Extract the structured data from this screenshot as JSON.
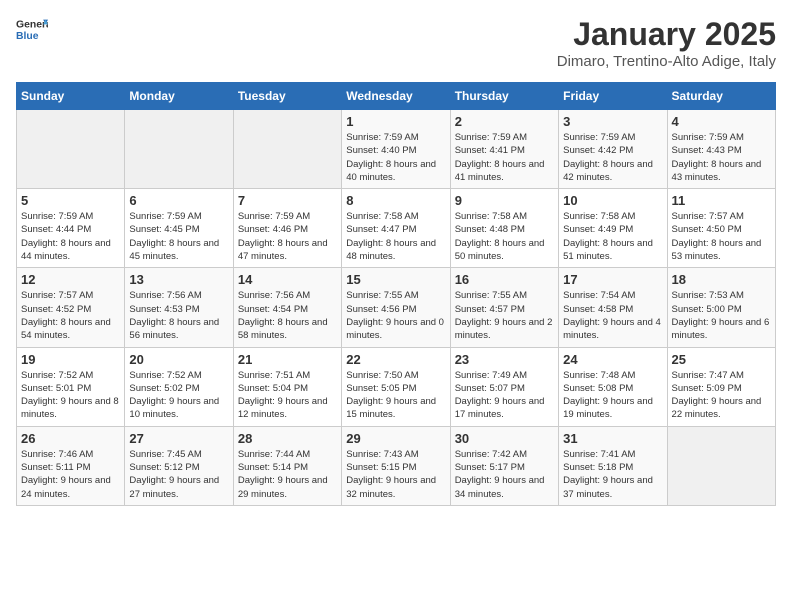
{
  "logo": {
    "text_general": "General",
    "text_blue": "Blue"
  },
  "title": "January 2025",
  "subtitle": "Dimaro, Trentino-Alto Adige, Italy",
  "weekdays": [
    "Sunday",
    "Monday",
    "Tuesday",
    "Wednesday",
    "Thursday",
    "Friday",
    "Saturday"
  ],
  "weeks": [
    [
      {
        "day": "",
        "info": ""
      },
      {
        "day": "",
        "info": ""
      },
      {
        "day": "",
        "info": ""
      },
      {
        "day": "1",
        "info": "Sunrise: 7:59 AM\nSunset: 4:40 PM\nDaylight: 8 hours and 40 minutes."
      },
      {
        "day": "2",
        "info": "Sunrise: 7:59 AM\nSunset: 4:41 PM\nDaylight: 8 hours and 41 minutes."
      },
      {
        "day": "3",
        "info": "Sunrise: 7:59 AM\nSunset: 4:42 PM\nDaylight: 8 hours and 42 minutes."
      },
      {
        "day": "4",
        "info": "Sunrise: 7:59 AM\nSunset: 4:43 PM\nDaylight: 8 hours and 43 minutes."
      }
    ],
    [
      {
        "day": "5",
        "info": "Sunrise: 7:59 AM\nSunset: 4:44 PM\nDaylight: 8 hours and 44 minutes."
      },
      {
        "day": "6",
        "info": "Sunrise: 7:59 AM\nSunset: 4:45 PM\nDaylight: 8 hours and 45 minutes."
      },
      {
        "day": "7",
        "info": "Sunrise: 7:59 AM\nSunset: 4:46 PM\nDaylight: 8 hours and 47 minutes."
      },
      {
        "day": "8",
        "info": "Sunrise: 7:58 AM\nSunset: 4:47 PM\nDaylight: 8 hours and 48 minutes."
      },
      {
        "day": "9",
        "info": "Sunrise: 7:58 AM\nSunset: 4:48 PM\nDaylight: 8 hours and 50 minutes."
      },
      {
        "day": "10",
        "info": "Sunrise: 7:58 AM\nSunset: 4:49 PM\nDaylight: 8 hours and 51 minutes."
      },
      {
        "day": "11",
        "info": "Sunrise: 7:57 AM\nSunset: 4:50 PM\nDaylight: 8 hours and 53 minutes."
      }
    ],
    [
      {
        "day": "12",
        "info": "Sunrise: 7:57 AM\nSunset: 4:52 PM\nDaylight: 8 hours and 54 minutes."
      },
      {
        "day": "13",
        "info": "Sunrise: 7:56 AM\nSunset: 4:53 PM\nDaylight: 8 hours and 56 minutes."
      },
      {
        "day": "14",
        "info": "Sunrise: 7:56 AM\nSunset: 4:54 PM\nDaylight: 8 hours and 58 minutes."
      },
      {
        "day": "15",
        "info": "Sunrise: 7:55 AM\nSunset: 4:56 PM\nDaylight: 9 hours and 0 minutes."
      },
      {
        "day": "16",
        "info": "Sunrise: 7:55 AM\nSunset: 4:57 PM\nDaylight: 9 hours and 2 minutes."
      },
      {
        "day": "17",
        "info": "Sunrise: 7:54 AM\nSunset: 4:58 PM\nDaylight: 9 hours and 4 minutes."
      },
      {
        "day": "18",
        "info": "Sunrise: 7:53 AM\nSunset: 5:00 PM\nDaylight: 9 hours and 6 minutes."
      }
    ],
    [
      {
        "day": "19",
        "info": "Sunrise: 7:52 AM\nSunset: 5:01 PM\nDaylight: 9 hours and 8 minutes."
      },
      {
        "day": "20",
        "info": "Sunrise: 7:52 AM\nSunset: 5:02 PM\nDaylight: 9 hours and 10 minutes."
      },
      {
        "day": "21",
        "info": "Sunrise: 7:51 AM\nSunset: 5:04 PM\nDaylight: 9 hours and 12 minutes."
      },
      {
        "day": "22",
        "info": "Sunrise: 7:50 AM\nSunset: 5:05 PM\nDaylight: 9 hours and 15 minutes."
      },
      {
        "day": "23",
        "info": "Sunrise: 7:49 AM\nSunset: 5:07 PM\nDaylight: 9 hours and 17 minutes."
      },
      {
        "day": "24",
        "info": "Sunrise: 7:48 AM\nSunset: 5:08 PM\nDaylight: 9 hours and 19 minutes."
      },
      {
        "day": "25",
        "info": "Sunrise: 7:47 AM\nSunset: 5:09 PM\nDaylight: 9 hours and 22 minutes."
      }
    ],
    [
      {
        "day": "26",
        "info": "Sunrise: 7:46 AM\nSunset: 5:11 PM\nDaylight: 9 hours and 24 minutes."
      },
      {
        "day": "27",
        "info": "Sunrise: 7:45 AM\nSunset: 5:12 PM\nDaylight: 9 hours and 27 minutes."
      },
      {
        "day": "28",
        "info": "Sunrise: 7:44 AM\nSunset: 5:14 PM\nDaylight: 9 hours and 29 minutes."
      },
      {
        "day": "29",
        "info": "Sunrise: 7:43 AM\nSunset: 5:15 PM\nDaylight: 9 hours and 32 minutes."
      },
      {
        "day": "30",
        "info": "Sunrise: 7:42 AM\nSunset: 5:17 PM\nDaylight: 9 hours and 34 minutes."
      },
      {
        "day": "31",
        "info": "Sunrise: 7:41 AM\nSunset: 5:18 PM\nDaylight: 9 hours and 37 minutes."
      },
      {
        "day": "",
        "info": ""
      }
    ]
  ]
}
